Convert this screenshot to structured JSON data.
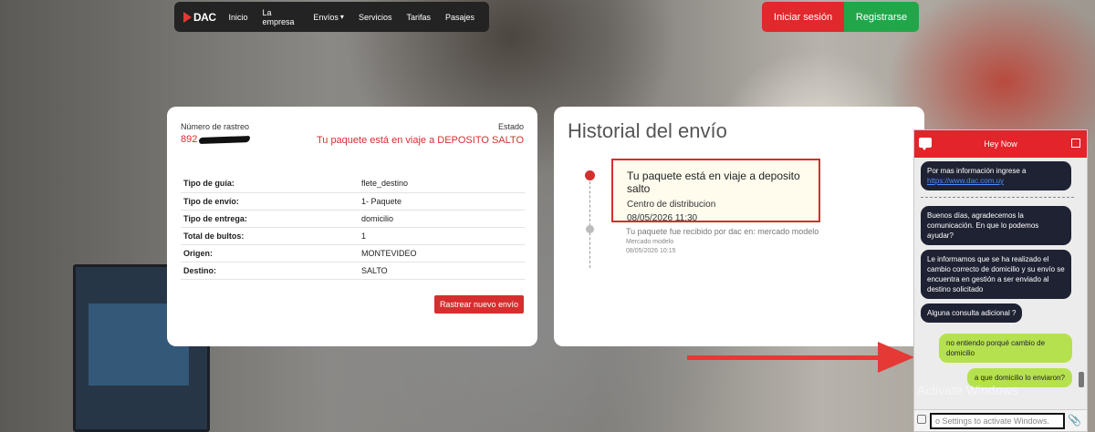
{
  "nav": {
    "logo": "DAC",
    "items": [
      "Inicio",
      "La empresa",
      "Envíos",
      "Servicios",
      "Tarifas",
      "Pasajes"
    ],
    "login": "Iniciar sesión",
    "register": "Registrarse"
  },
  "tracking": {
    "number_label": "Número de rastreo",
    "number_visible": "892",
    "status_label": "Estado",
    "status_value": "Tu paquete está en viaje a DEPOSITO SALTO",
    "details": [
      {
        "key": "Tipo de guía:",
        "value": "flete_destino"
      },
      {
        "key": "Tipo de envío:",
        "value": "1- Paquete"
      },
      {
        "key": "Tipo de entrega:",
        "value": "domicilio"
      },
      {
        "key": "Total de bultos:",
        "value": "1"
      },
      {
        "key": "Origen:",
        "value": "MONTEVIDEO"
      },
      {
        "key": "Destino:",
        "value": "SALTO"
      }
    ],
    "new_button": "Rastrear nuevo envío"
  },
  "history": {
    "title": "Historial del envío",
    "events": [
      {
        "title": "Tu paquete está en viaje a deposito salto",
        "place": "Centro de distribucion",
        "date": "08/05/2026 11:30"
      },
      {
        "title": "Tu paquete fue recibido por dac en: mercado modelo",
        "place": "Mercado modelo",
        "date": "08/05/2026 10:15"
      }
    ]
  },
  "chat": {
    "title": "Hey Now",
    "messages": [
      {
        "from": "agent",
        "text": "Por mas información ingrese a",
        "link": "https://www.dac.com.uy"
      },
      {
        "from": "agent",
        "text": "Buenos días, agradecemos la comunicación. En que lo podemos ayudar?"
      },
      {
        "from": "agent",
        "text": "Le informamos que se ha realizado el cambio correcto de domicilio y su envío se encuentra en gestión a ser enviado al destino solicitado"
      },
      {
        "from": "agent",
        "text": "Alguna consulta adicional ?"
      },
      {
        "from": "user",
        "text": "no entiendo porqué cambio de domicilio"
      },
      {
        "from": "user",
        "text": "a que domicilio lo enviaron?"
      }
    ],
    "input_value": "o Settings to activate Windows."
  },
  "watermark": "Activate Windows",
  "colors": {
    "accent_red": "#e0282d",
    "accent_green": "#22a64a",
    "chat_user": "#b6e14f",
    "chat_agent": "#1f2233"
  }
}
